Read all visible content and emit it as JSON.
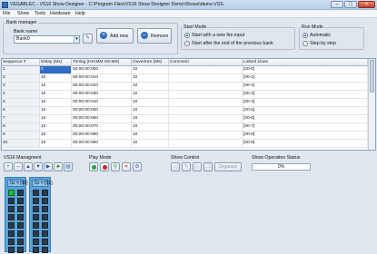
{
  "window": {
    "title": "VEGABLEC - VS16 Show Designer - C:\\Program Files\\VS16 Show Designer Demo\\Shows\\demo.VSS",
    "buttons": {
      "minimize": "–",
      "maximize": "□",
      "close": "×"
    }
  },
  "menu": [
    "File",
    "Show",
    "Tools",
    "Hardware",
    "Help"
  ],
  "bank_manager": {
    "group_label": "Bank manager",
    "bank_name_label": "Bank name",
    "bank_value": "Bank0",
    "add_new_label": "Add new",
    "remove_label": "Remove"
  },
  "start_mode": {
    "group_label": "Start Mode",
    "options": [
      {
        "label": "Start with a new fire input",
        "selected": true
      },
      {
        "label": "Start after the end of the previous bank",
        "selected": false
      }
    ]
  },
  "run_mode": {
    "group_label": "Run Mode",
    "options": [
      {
        "label": "Automatic",
        "selected": true
      },
      {
        "label": "Step by step",
        "selected": false
      }
    ]
  },
  "table": {
    "columns": [
      "Sequence #",
      "Delay (Ms)",
      "Timing (HH:MM:SS:MS)",
      "Ouverture (Ms)",
      "Comment",
      "Linked Lines"
    ],
    "rows": [
      [
        "1",
        "0",
        "00:00:00:000",
        "10",
        "",
        "[00-0]"
      ],
      [
        "2",
        "10",
        "00:00:00:010",
        "10",
        "",
        "[00-1]"
      ],
      [
        "3",
        "10",
        "00:00:00:020",
        "10",
        "",
        "[00-2]"
      ],
      [
        "4",
        "10",
        "00:00:00:030",
        "10",
        "",
        "[00-3]"
      ],
      [
        "5",
        "10",
        "00:00:00:040",
        "10",
        "",
        "[00-4]"
      ],
      [
        "6",
        "10",
        "00:00:00:050",
        "10",
        "",
        "[00-5]"
      ],
      [
        "7",
        "10",
        "00:00:00:060",
        "10",
        "",
        "[00-6]"
      ],
      [
        "8",
        "10",
        "00:00:00:070",
        "10",
        "",
        "[00-7]"
      ],
      [
        "9",
        "10",
        "00:00:00:080",
        "10",
        "",
        "[00-8]"
      ],
      [
        "10",
        "10",
        "00:00:00:090",
        "10",
        "",
        "[00-9]"
      ]
    ]
  },
  "vs16_management": {
    "label": "VS16 Managment",
    "panel_a_label": "Gr = [00]",
    "panel_b_label": "Gr = [01]"
  },
  "play_mode": {
    "label": "Play Mode"
  },
  "show_control": {
    "label": "Show Control",
    "organize_label": "Organize"
  },
  "show_status": {
    "label": "Show Operation Status",
    "progress_text": "0%",
    "progress_value": 0
  },
  "colors": {
    "accent": "#2f6ec2",
    "panel": "#5aa2d8",
    "channel_active": "#1fbd3a",
    "channel_idle": "#2d3a4c"
  }
}
